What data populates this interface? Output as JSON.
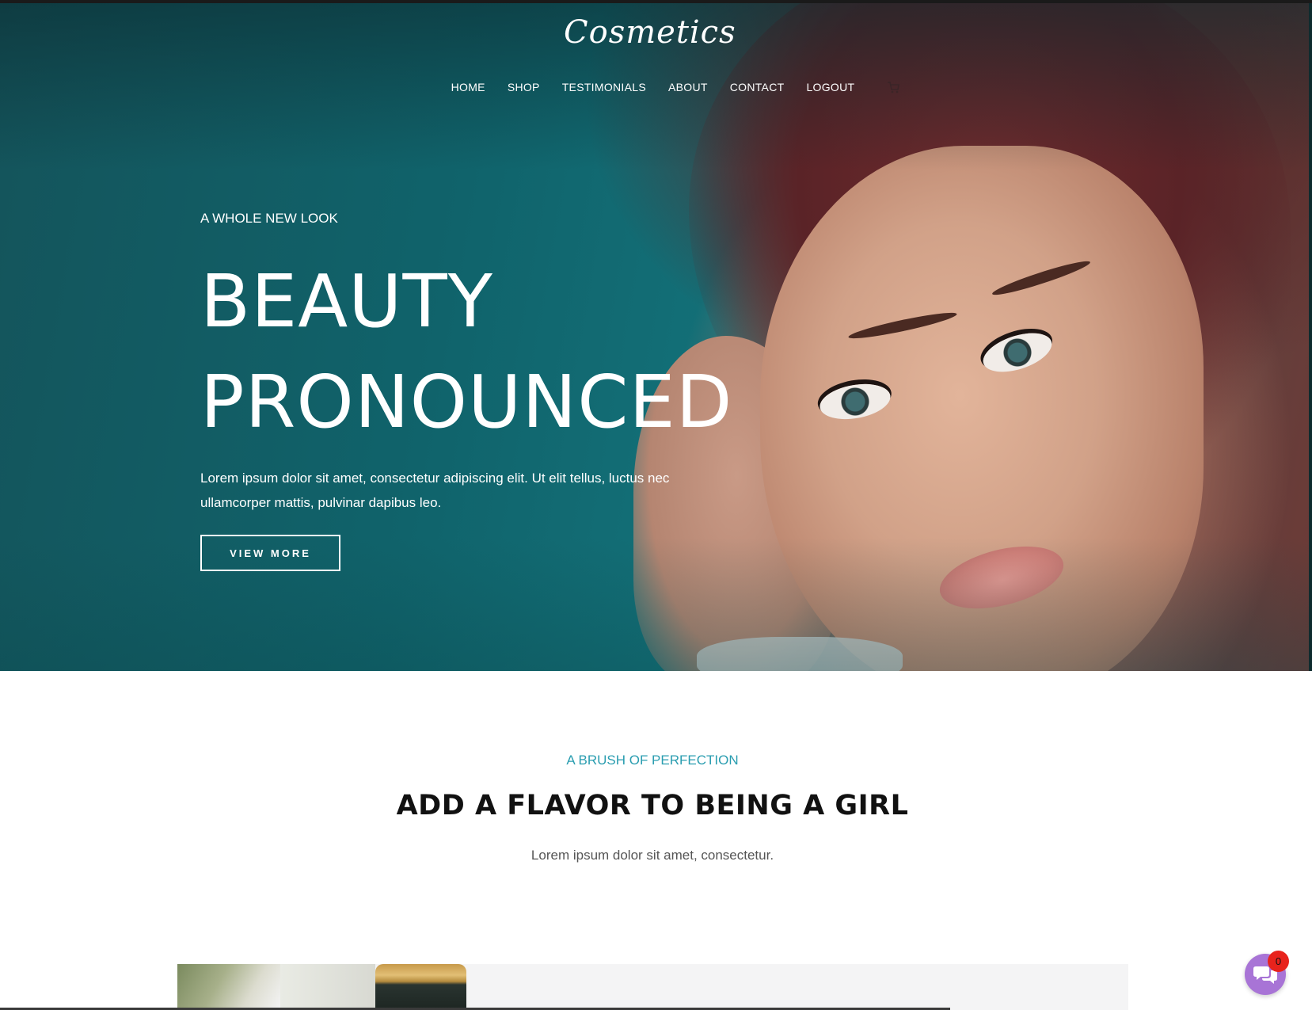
{
  "brand": {
    "logo_text": "Cosmetics"
  },
  "nav": {
    "items": [
      "HOME",
      "SHOP",
      "TESTIMONIALS",
      "ABOUT",
      "CONTACT",
      "LOGOUT"
    ],
    "cart_icon": "cart-icon"
  },
  "hero": {
    "eyebrow": "A WHOLE NEW LOOK",
    "headline_line1": "BEAUTY",
    "headline_line2": "PRONOUNCED",
    "description": "Lorem ipsum dolor sit amet, consectetur adipiscing elit. Ut elit tellus, luctus nec ullamcorper mattis, pulvinar dapibus leo.",
    "cta_label": "VIEW MORE"
  },
  "section": {
    "kicker": "A BRUSH OF PERFECTION",
    "title": "ADD A FLAVOR TO BEING A GIRL",
    "subtitle": "Lorem ipsum dolor sit amet, consectetur."
  },
  "chat": {
    "icon": "chat-bubbles-icon",
    "badge_count": "0"
  },
  "colors": {
    "accent": "#2a9db0",
    "hero_teal": "#10636b",
    "chat_purple": "#a874d6",
    "badge_red": "#e8231c"
  }
}
